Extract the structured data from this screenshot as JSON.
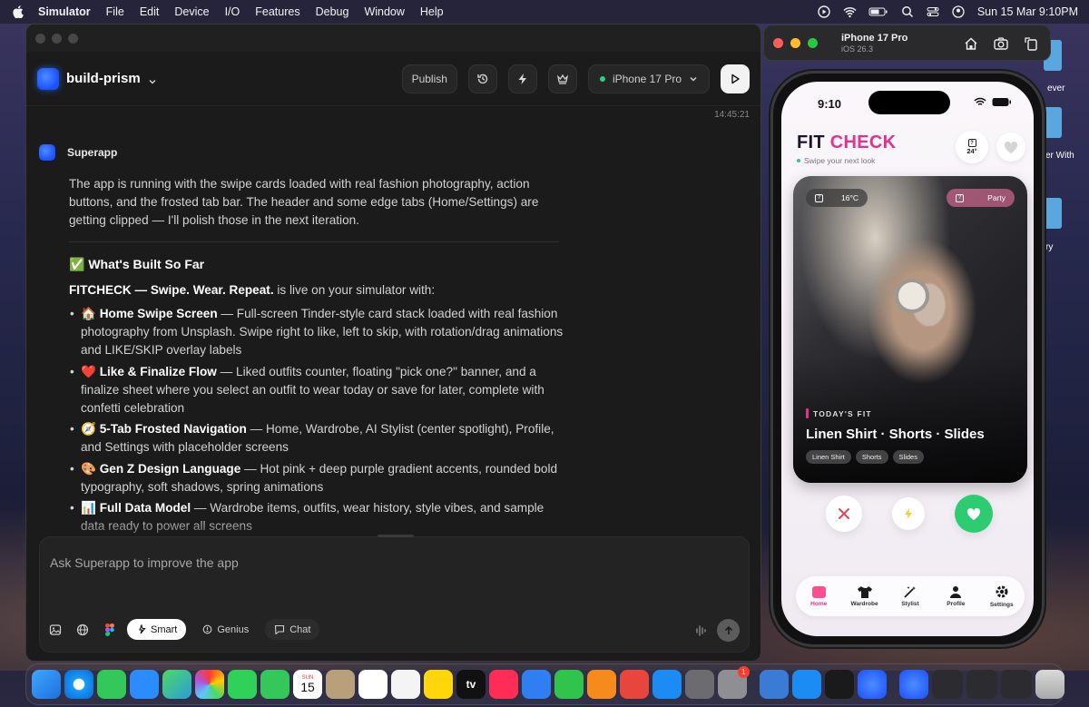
{
  "menubar": {
    "app_name": "Simulator",
    "items": [
      "File",
      "Edit",
      "Device",
      "I/O",
      "Features",
      "Debug",
      "Window",
      "Help"
    ],
    "clock": "Sun 15 Mar  9:10PM"
  },
  "desktop": {
    "labels": [
      "ever",
      "er With",
      "ry"
    ]
  },
  "window": {
    "project_name": "build-prism",
    "publish_label": "Publish",
    "device_label": "iPhone 17 Pro",
    "timestamp": "14:45:21"
  },
  "chat": {
    "author": "Superapp",
    "intro": "The app is running with the swipe cards loaded with real fashion photography, action buttons, and the frosted tab bar. The header and some edge tabs (Home/Settings) are getting clipped — I'll polish those in the next iteration.",
    "section_title": "✅ What's Built So Far",
    "lead_bold": "FITCHECK — Swipe. Wear. Repeat.",
    "lead_rest": " is live on your simulator with:",
    "bullets": [
      {
        "title": "🏠 Home Swipe Screen",
        "text": " — Full-screen Tinder-style card stack loaded with real fashion photography from Unsplash. Swipe right to like, left to skip, with rotation/drag animations and LIKE/SKIP overlay labels"
      },
      {
        "title": "❤️ Like & Finalize Flow",
        "text": " — Liked outfits counter, floating \"pick one?\" banner, and a finalize sheet where you select an outfit to wear today or save for later, complete with confetti celebration"
      },
      {
        "title": "🧭 5-Tab Frosted Navigation",
        "text": " — Home, Wardrobe, AI Stylist (center spotlight), Profile, and Settings with placeholder screens"
      },
      {
        "title": "🎨 Gen Z Design Language",
        "text": " — Hot pink + deep purple gradient accents, rounded bold typography, soft shadows, spring animations"
      },
      {
        "title": "📊 Full Data Model",
        "text": " — Wardrobe items, outfits, wear history, style vibes, and sample data ready to power all screens"
      }
    ]
  },
  "composer": {
    "placeholder": "Ask Superapp to improve the app",
    "smart_label": "Smart",
    "genius_label": "Genius",
    "chat_label": "Chat"
  },
  "simulator": {
    "title": "iPhone 17 Pro",
    "subtitle": "iOS 26.3"
  },
  "phone": {
    "time": "9:10",
    "app_title_a": "FIT ",
    "app_title_b": "CHECK",
    "tagline": "Swipe your next look",
    "weather": "24°",
    "chip_temp": "16°C",
    "chip_party": "Party",
    "todays_label": "TODAY'S FIT",
    "outfit_name": "Linen Shirt · Shorts · Slides",
    "tags": [
      "Linen Shirt",
      "Shorts",
      "Slides"
    ],
    "tabs": [
      "Home",
      "Wardrobe",
      "Stylist",
      "Profile",
      "Settings"
    ]
  },
  "dock": {
    "calendar_month": "SUN",
    "calendar_day": "15",
    "tv_label": "tv",
    "badge": "1"
  },
  "colors": {
    "accent_pink": "#e3318d",
    "like_green": "#2ecc71",
    "status_green": "#2bd07b",
    "brand_blue": "#1b4fff"
  }
}
